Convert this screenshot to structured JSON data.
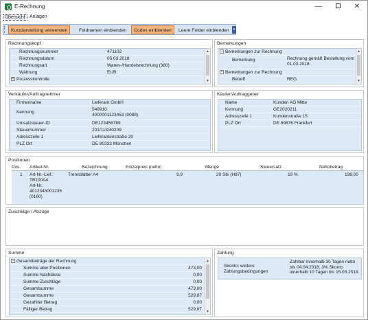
{
  "window": {
    "title": "E-Rechnung",
    "minimize": "—",
    "close": "✕"
  },
  "menu": {
    "items": [
      "Übersicht",
      "Anlagen"
    ]
  },
  "toolbar": {
    "buttons": [
      {
        "label": "Kurzdarstellung verwenden",
        "active": true
      },
      {
        "label": "Feldnamen einblenden",
        "active": false
      },
      {
        "label": "Codes einblenden",
        "active": true
      },
      {
        "label": "Leere Felder einblenden",
        "active": false
      }
    ]
  },
  "rechnungskopf": {
    "title": "Rechnungskopf",
    "rows": [
      {
        "label": "Rechnungsnummer",
        "value": "471102"
      },
      {
        "label": "Rechnungsdatum",
        "value": "05.03.2018"
      },
      {
        "label": "Rechnungsart",
        "value": "Waren-/Handelsrechnung (380)"
      },
      {
        "label": "Währung",
        "value": "EUR"
      }
    ],
    "group": "Prozesskontrolle"
  },
  "bemerkungen": {
    "title": "Bemerkungen",
    "group1": "Bemerkungen zur Rechnung",
    "row1": {
      "label": "Bemerkung",
      "value": "Rechnung gemäß Bestellung vom 01.03.2018."
    },
    "group2": "Bemerkungen zur Rechnung",
    "row2": {
      "label": "Betreff",
      "value": "REG"
    }
  },
  "verkaeufer": {
    "title": "Verkäufer/Auftragnehmer",
    "rows": [
      {
        "label": "Firmenname",
        "value": "Lieferant GmbH"
      },
      {
        "label": "Kennung",
        "value": "549910\n4000001123453 (0088)"
      },
      {
        "label": "Umsatzsteuer-ID",
        "value": "DE123456789"
      },
      {
        "label": "Steuernummer",
        "value": "201/113/40209"
      },
      {
        "label": "Adresszeile 1",
        "value": "Lieferantenstraße 20"
      },
      {
        "label": "PLZ Ort",
        "value": "DE 80333 München"
      }
    ]
  },
  "kaeufer": {
    "title": "Käufer/Auftraggeber",
    "rows": [
      {
        "label": "Name",
        "value": "Kunden AG Mitte"
      },
      {
        "label": "Kennung",
        "value": "GE2020211"
      },
      {
        "label": "Adresszeile 1",
        "value": "Kundenstraße 15"
      },
      {
        "label": "PLZ Ort",
        "value": "DE 69876 Frankfurt"
      }
    ]
  },
  "positionen": {
    "title": "Positionen",
    "headers": [
      "Pos.",
      "Artikel-Nr.",
      "Bezeichnung",
      "Einzelpreis (netto)",
      "Menge",
      "Steuersatz",
      "Nettobetrag"
    ],
    "row": {
      "pos": "1",
      "artikel": "Art-Nr.-Lief.:\nTB100A4\nArt-Nr.:\n4012345001235\n(0160)",
      "bezeichnung": "Trennblätter A4",
      "einzelpreis": "9,9",
      "menge": "20 Stk (H87)",
      "steuersatz": "19 %",
      "nettobetrag": "198,00"
    }
  },
  "zuschlaege": {
    "title": "Zuschläge / Abzüge"
  },
  "summe": {
    "title": "Summe",
    "group": "Gesamtbeträge der Rechnung",
    "rows": [
      {
        "label": "Summe aller Positionen",
        "value": "473,00"
      },
      {
        "label": "Summe Nachlässe",
        "value": "0,00"
      },
      {
        "label": "Summe Zuschläge",
        "value": "0,00"
      },
      {
        "label": "Gesamtsumme",
        "value": "473,00"
      },
      {
        "label": "Gesamtsumme",
        "value": "529,87"
      },
      {
        "label": "Gezahlter Betrag",
        "value": "0,00"
      },
      {
        "label": "Fälliger Betrag",
        "value": "529,87"
      }
    ]
  },
  "zahlung": {
    "title": "Zahlung",
    "label": "Skonto; weitere Zahlungsbedingungen",
    "value": "Zahlbar innerhalb 30 Tagen netto bis 04.04.2018, 3% Skonto innerhalb 10 Tagen bis 15.03.2018."
  },
  "colors": {
    "accent_button": "#f5b47a",
    "grid_bg": "#dce9f7",
    "toolbar_bg": "#d8e4f4"
  }
}
